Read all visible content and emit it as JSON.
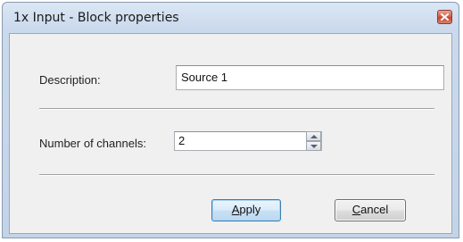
{
  "window": {
    "title": "1x Input - Block properties",
    "close_icon": "close-icon"
  },
  "form": {
    "description_label": "Description:",
    "description_value": "Source 1",
    "channels_label": "Number of channels:",
    "channels_value": "2",
    "spinner_icons": [
      "chevron-up-icon",
      "chevron-down-icon"
    ]
  },
  "buttons": {
    "apply": {
      "mnemonic": "A",
      "rest": "pply"
    },
    "cancel": {
      "mnemonic": "C",
      "rest": "ancel"
    }
  },
  "colors": {
    "close_button": "#c44530",
    "default_button_border": "#3c7fb1",
    "title_bar": "#cad9ec"
  }
}
